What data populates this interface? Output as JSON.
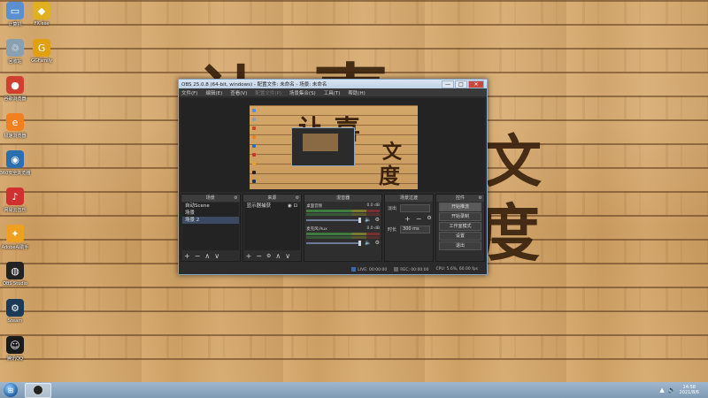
{
  "desktop": {
    "icons": [
      {
        "name": "computer",
        "label": "计算机",
        "glyph": "▭",
        "color": "#5a8fd0"
      },
      {
        "name": "fx",
        "label": "FX.exe",
        "glyph": "◆",
        "color": "#e0b020"
      },
      {
        "name": "recycle-bin",
        "label": "回收站",
        "glyph": "♲",
        "color": "#8aa0b0"
      },
      {
        "name": "gamejump",
        "label": "GGFamily",
        "glyph": "G",
        "color": "#e0a010"
      },
      {
        "name": "chrome",
        "label": "谷歌浏览器",
        "glyph": "●",
        "color": "#d04030"
      },
      {
        "name": "browser",
        "label": "极速浏览器",
        "glyph": "e",
        "color": "#f08020"
      },
      {
        "name": "backup",
        "label": "360安全浏览器",
        "glyph": "◉",
        "color": "#2a6fb0"
      },
      {
        "name": "netease",
        "label": "网易云音乐",
        "glyph": "♪",
        "color": "#d03030"
      },
      {
        "name": "assistant",
        "label": "AdobeAI助手",
        "glyph": "✦",
        "color": "#f0a020"
      },
      {
        "name": "obs",
        "label": "OBS Studio",
        "glyph": "◍",
        "color": "#222222"
      },
      {
        "name": "steam",
        "label": "Steam",
        "glyph": "⚙",
        "color": "#1b3a5a"
      },
      {
        "name": "qq",
        "label": "腾讯QQ",
        "glyph": "☺",
        "color": "#1a1a1a"
      }
    ],
    "calligraphy": [
      "让",
      "喜",
      "文",
      "度"
    ]
  },
  "obs": {
    "title": "OBS 25.0.8 (64-bit, windows) - 配置文件: 未命名 - 场景: 未命名",
    "window_buttons": {
      "min": "—",
      "max": "□",
      "close": "✕"
    },
    "menu": [
      "文件(F)",
      "编辑(E)",
      "查看(V)",
      "配置文件(P)",
      "场景集合(S)",
      "工具(T)",
      "帮助(H)"
    ],
    "docks": {
      "scenes": {
        "title": "场景",
        "items": [
          "自动Scene",
          "场景",
          "场景 2"
        ]
      },
      "sources": {
        "title": "来源",
        "items": [
          "显示器捕获"
        ]
      },
      "mixer": {
        "title": "混音器",
        "tracks": [
          {
            "name": "桌面音频",
            "level": "0.0 dB"
          },
          {
            "name": "麦克风/Aux",
            "level": "0.0 dB"
          }
        ]
      },
      "transitions": {
        "title": "场景过渡",
        "label1": "淡出",
        "label2": "时长",
        "duration": "300 ms"
      },
      "controls": {
        "title": "控件",
        "buttons": [
          "开始推流",
          "开始录制",
          "工作室模式",
          "设置",
          "退出"
        ]
      }
    },
    "status": {
      "live": "LIVE: 00:00:00",
      "rec": "REC: 00:00:00",
      "cpu": "CPU: 5.6%, 60.00 fps"
    }
  },
  "taskbar": {
    "start_glyph": "⊞",
    "clock_time": "14:58",
    "clock_date": "2021/8/6"
  }
}
